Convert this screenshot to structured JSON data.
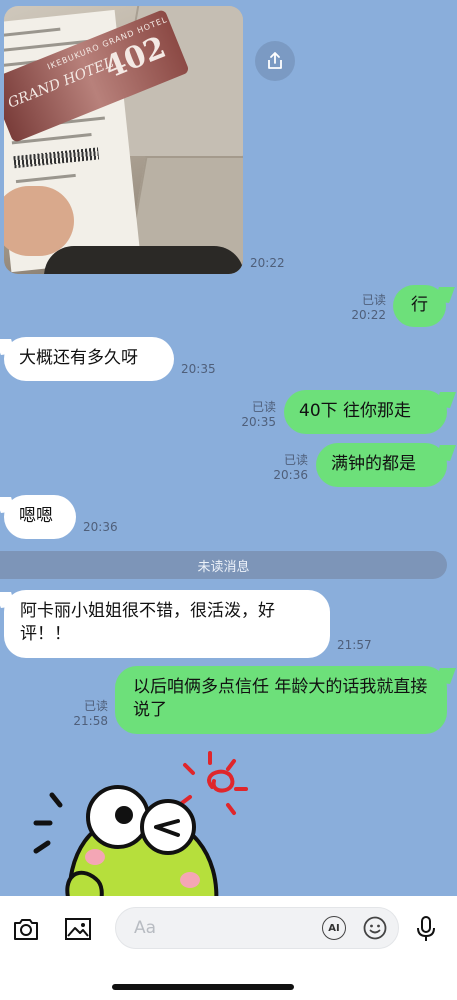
{
  "messages": [
    {
      "id": "photo",
      "side": "in",
      "type": "image",
      "time": "20:22",
      "tag_number": "402",
      "tag_top": "IKEBUKURO GRAND HOTEL",
      "tag_logo": "GRAND HOTEL"
    },
    {
      "id": "m1",
      "side": "out",
      "text": "行",
      "time": "20:22",
      "read": "已读"
    },
    {
      "id": "m2",
      "side": "in",
      "text": "大概还有多久呀",
      "time": "20:35"
    },
    {
      "id": "m3",
      "side": "out",
      "text": "40下 往你那走",
      "time": "20:35",
      "read": "已读"
    },
    {
      "id": "m4",
      "side": "out",
      "text": "满钟的都是",
      "time": "20:36",
      "read": "已读"
    },
    {
      "id": "m5",
      "side": "in",
      "text": "嗯嗯",
      "time": "20:36"
    },
    {
      "id": "m6",
      "side": "in",
      "text": "阿卡丽小姐姐很不错，很活泼，好评！！",
      "time": "21:57"
    },
    {
      "id": "m7",
      "side": "out",
      "text": "以后咱俩多点信任 年龄大的话我就直接说了",
      "time": "21:58",
      "read": "已读"
    }
  ],
  "unread_divider": "未读消息",
  "input": {
    "placeholder": "Aa",
    "ai_label": "AI"
  },
  "icons": {
    "share": "share-icon",
    "camera": "camera-icon",
    "gallery": "image-icon",
    "ai": "ai-icon",
    "emoji": "emoji-icon",
    "mic": "microphone-icon"
  },
  "colors": {
    "background": "#8aaedb",
    "incoming": "#ffffff",
    "outgoing": "#6de07a",
    "divider": "#7d95b8"
  }
}
